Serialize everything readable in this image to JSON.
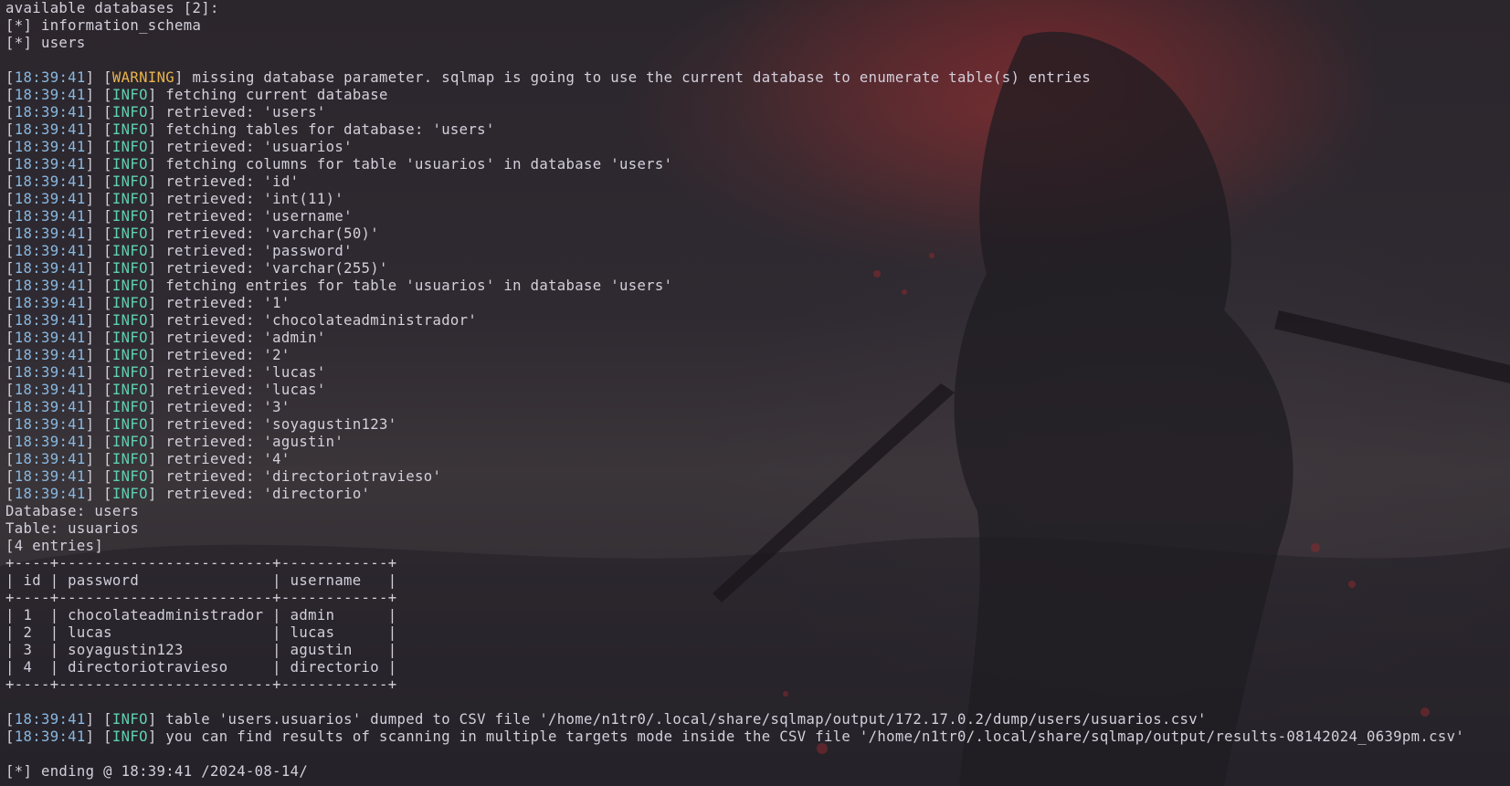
{
  "lines": [
    {
      "type": "plain",
      "text": "available databases [2]:"
    },
    {
      "type": "plain",
      "text": "[*] information_schema"
    },
    {
      "type": "plain",
      "text": "[*] users"
    },
    {
      "type": "plain",
      "text": ""
    },
    {
      "type": "log",
      "ts": "18:39:41",
      "level": "WARNING",
      "msg": "missing database parameter. sqlmap is going to use the current database to enumerate table(s) entries"
    },
    {
      "type": "log",
      "ts": "18:39:41",
      "level": "INFO",
      "msg": "fetching current database"
    },
    {
      "type": "log",
      "ts": "18:39:41",
      "level": "INFO",
      "msg": "retrieved: 'users'"
    },
    {
      "type": "log",
      "ts": "18:39:41",
      "level": "INFO",
      "msg": "fetching tables for database: 'users'"
    },
    {
      "type": "log",
      "ts": "18:39:41",
      "level": "INFO",
      "msg": "retrieved: 'usuarios'"
    },
    {
      "type": "log",
      "ts": "18:39:41",
      "level": "INFO",
      "msg": "fetching columns for table 'usuarios' in database 'users'"
    },
    {
      "type": "log",
      "ts": "18:39:41",
      "level": "INFO",
      "msg": "retrieved: 'id'"
    },
    {
      "type": "log",
      "ts": "18:39:41",
      "level": "INFO",
      "msg": "retrieved: 'int(11)'"
    },
    {
      "type": "log",
      "ts": "18:39:41",
      "level": "INFO",
      "msg": "retrieved: 'username'"
    },
    {
      "type": "log",
      "ts": "18:39:41",
      "level": "INFO",
      "msg": "retrieved: 'varchar(50)'"
    },
    {
      "type": "log",
      "ts": "18:39:41",
      "level": "INFO",
      "msg": "retrieved: 'password'"
    },
    {
      "type": "log",
      "ts": "18:39:41",
      "level": "INFO",
      "msg": "retrieved: 'varchar(255)'"
    },
    {
      "type": "log",
      "ts": "18:39:41",
      "level": "INFO",
      "msg": "fetching entries for table 'usuarios' in database 'users'"
    },
    {
      "type": "log",
      "ts": "18:39:41",
      "level": "INFO",
      "msg": "retrieved: '1'"
    },
    {
      "type": "log",
      "ts": "18:39:41",
      "level": "INFO",
      "msg": "retrieved: 'chocolateadministrador'"
    },
    {
      "type": "log",
      "ts": "18:39:41",
      "level": "INFO",
      "msg": "retrieved: 'admin'"
    },
    {
      "type": "log",
      "ts": "18:39:41",
      "level": "INFO",
      "msg": "retrieved: '2'"
    },
    {
      "type": "log",
      "ts": "18:39:41",
      "level": "INFO",
      "msg": "retrieved: 'lucas'"
    },
    {
      "type": "log",
      "ts": "18:39:41",
      "level": "INFO",
      "msg": "retrieved: 'lucas'"
    },
    {
      "type": "log",
      "ts": "18:39:41",
      "level": "INFO",
      "msg": "retrieved: '3'"
    },
    {
      "type": "log",
      "ts": "18:39:41",
      "level": "INFO",
      "msg": "retrieved: 'soyagustin123'"
    },
    {
      "type": "log",
      "ts": "18:39:41",
      "level": "INFO",
      "msg": "retrieved: 'agustin'"
    },
    {
      "type": "log",
      "ts": "18:39:41",
      "level": "INFO",
      "msg": "retrieved: '4'"
    },
    {
      "type": "log",
      "ts": "18:39:41",
      "level": "INFO",
      "msg": "retrieved: 'directoriotravieso'"
    },
    {
      "type": "log",
      "ts": "18:39:41",
      "level": "INFO",
      "msg": "retrieved: 'directorio'"
    },
    {
      "type": "plain",
      "text": "Database: users"
    },
    {
      "type": "plain",
      "text": "Table: usuarios"
    },
    {
      "type": "plain",
      "text": "[4 entries]"
    },
    {
      "type": "plain",
      "text": "+----+------------------------+------------+"
    },
    {
      "type": "plain",
      "text": "| id | password               | username   |"
    },
    {
      "type": "plain",
      "text": "+----+------------------------+------------+"
    },
    {
      "type": "plain",
      "text": "| 1  | chocolateadministrador | admin      |"
    },
    {
      "type": "plain",
      "text": "| 2  | lucas                  | lucas      |"
    },
    {
      "type": "plain",
      "text": "| 3  | soyagustin123          | agustin    |"
    },
    {
      "type": "plain",
      "text": "| 4  | directoriotravieso     | directorio |"
    },
    {
      "type": "plain",
      "text": "+----+------------------------+------------+"
    },
    {
      "type": "plain",
      "text": ""
    },
    {
      "type": "log",
      "ts": "18:39:41",
      "level": "INFO",
      "msg": "table 'users.usuarios' dumped to CSV file '/home/n1tr0/.local/share/sqlmap/output/172.17.0.2/dump/users/usuarios.csv'"
    },
    {
      "type": "log",
      "ts": "18:39:41",
      "level": "INFO",
      "msg": "you can find results of scanning in multiple targets mode inside the CSV file '/home/n1tr0/.local/share/sqlmap/output/results-08142024_0639pm.csv'"
    },
    {
      "type": "plain",
      "text": ""
    },
    {
      "type": "plain",
      "text": "[*] ending @ 18:39:41 /2024-08-14/"
    }
  ],
  "colors": {
    "timestamp": "#89b8e0",
    "info": "#5fd0b2",
    "warning": "#e9b44c",
    "text": "#d3d0dc",
    "background": "#26232b"
  }
}
